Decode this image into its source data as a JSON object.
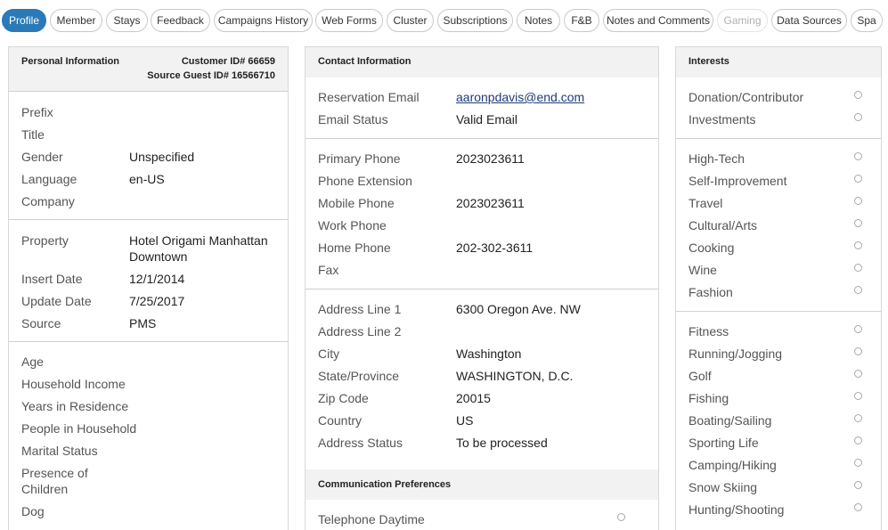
{
  "tabs": [
    "Profile",
    "Member",
    "Stays",
    "Feedback",
    "Campaigns History",
    "Web Forms",
    "Cluster",
    "Subscriptions",
    "Notes",
    "F&B",
    "Notes and Comments",
    "Gaming",
    "Data Sources",
    "Spa"
  ],
  "personal": {
    "title": "Personal Information",
    "customer_id": "Customer ID# 66659",
    "source_guest_id": "Source Guest ID# 16566710",
    "sec1": [
      {
        "label": "Prefix",
        "value": ""
      },
      {
        "label": "Title",
        "value": ""
      },
      {
        "label": "Gender",
        "value": "Unspecified"
      },
      {
        "label": "Language",
        "value": "en-US"
      },
      {
        "label": "Company",
        "value": ""
      }
    ],
    "property_label": "Property",
    "property_value_1": "Hotel Origami Manhattan",
    "property_value_2": "Downtown",
    "sec2": [
      {
        "label": "Insert Date",
        "value": "12/1/2014"
      },
      {
        "label": "Update Date",
        "value": "7/25/2017"
      },
      {
        "label": "Source",
        "value": "PMS"
      }
    ],
    "sec3": [
      "Age",
      "Household Income",
      "Years in Residence",
      "People in Household",
      "Marital Status"
    ],
    "presence_1": "Presence of",
    "presence_2": "Children",
    "dog": "Dog"
  },
  "contact": {
    "title": "Contact Information",
    "email": [
      {
        "label": "Reservation Email",
        "value": "aaronpdavis@end.com"
      },
      {
        "label": "Email Status",
        "value": "Valid Email"
      }
    ],
    "phones": [
      {
        "label": "Primary Phone",
        "value": "2023023611"
      },
      {
        "label": "Phone Extension",
        "value": ""
      },
      {
        "label": "Mobile Phone",
        "value": "2023023611"
      },
      {
        "label": "Work Phone",
        "value": ""
      },
      {
        "label": "Home Phone",
        "value": "202-302-3611"
      },
      {
        "label": "Fax",
        "value": ""
      }
    ],
    "address": [
      {
        "label": "Address Line 1",
        "value": "6300 Oregon Ave. NW"
      },
      {
        "label": "Address Line 2",
        "value": ""
      },
      {
        "label": "City",
        "value": "Washington"
      },
      {
        "label": "State/Province",
        "value": "WASHINGTON, D.C."
      },
      {
        "label": "Zip Code",
        "value": "20015"
      },
      {
        "label": "Country",
        "value": "US"
      },
      {
        "label": "Address Status",
        "value": "To be processed"
      }
    ],
    "comm_title": "Communication Preferences",
    "comm_first": "Telephone Daytime"
  },
  "interests": {
    "title": "Interests",
    "group1": [
      "Donation/Contributor",
      "Investments"
    ],
    "group2": [
      "High-Tech",
      "Self-Improvement",
      "Travel",
      "Cultural/Arts",
      "Cooking",
      "Wine",
      "Fashion"
    ],
    "group3": [
      "Fitness",
      "Running/Jogging",
      "Golf",
      "Fishing",
      "Boating/Sailing",
      "Sporting Life",
      "Camping/Hiking",
      "Snow Skiing",
      "Hunting/Shooting"
    ]
  }
}
